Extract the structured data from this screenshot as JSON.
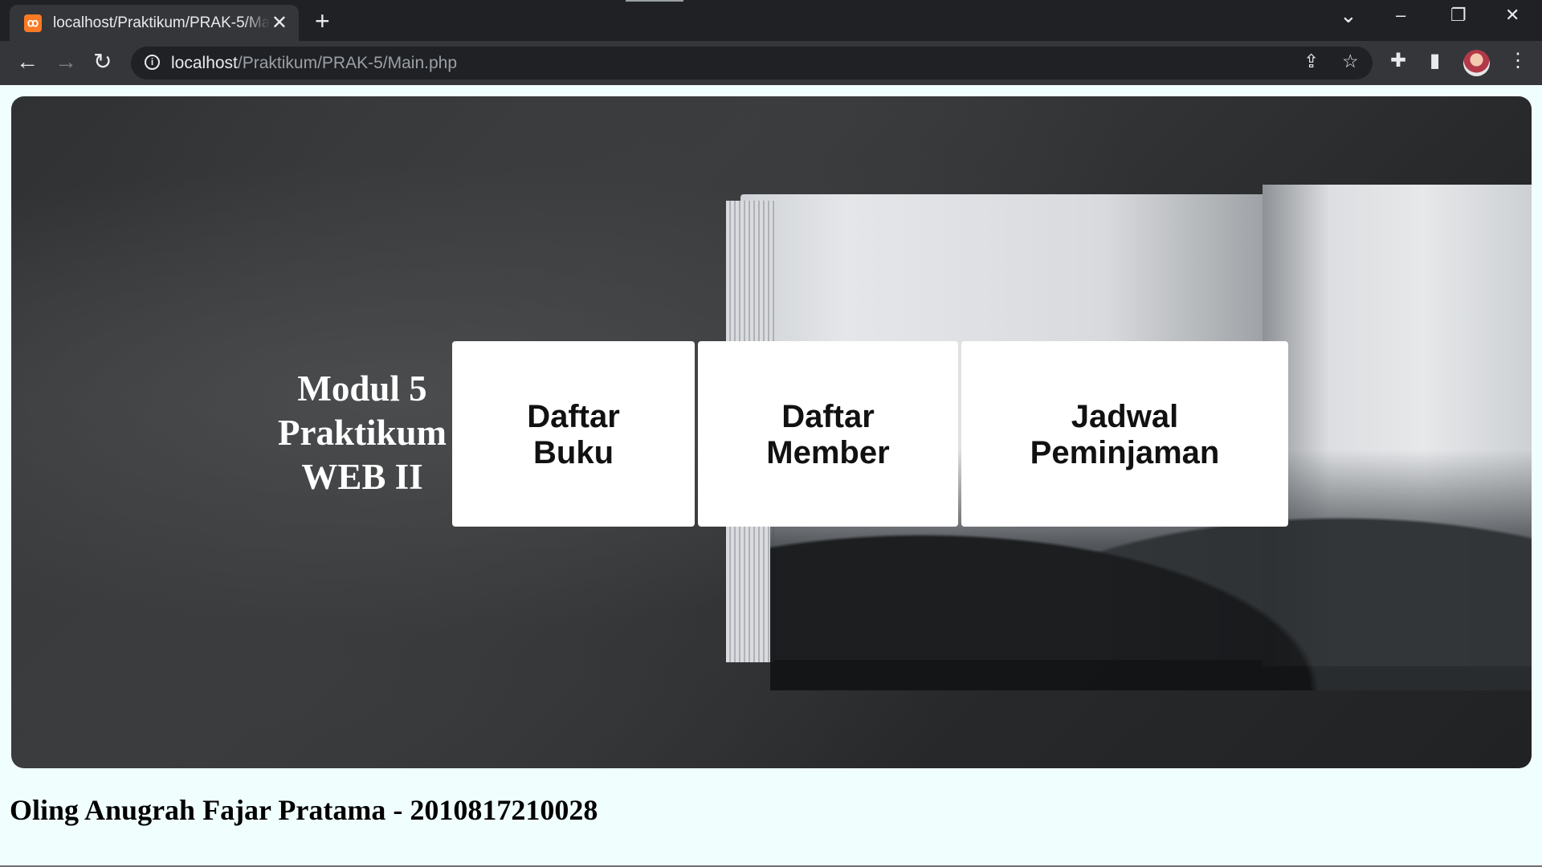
{
  "browser": {
    "tab_title": "localhost/Praktikum/PRAK-5/Main.php",
    "favicon_glyph": "ꝏ",
    "url_host": "localhost",
    "url_path": "/Praktikum/PRAK-5/Main.php",
    "icons": {
      "tab_close": "✕",
      "new_tab": "+",
      "tab_search": "⌄",
      "minimize": "–",
      "restore": "❐",
      "close": "✕",
      "back": "←",
      "forward": "→",
      "reload": "↻",
      "site_info": "i",
      "share": "⇪",
      "bookmark": "☆",
      "extensions": "✚",
      "side_panel": "▮",
      "menu": "⋮"
    }
  },
  "page": {
    "hero_title_lines": [
      "Modul 5",
      "Praktikum",
      "WEB II"
    ],
    "menu": [
      {
        "lines": [
          "Daftar",
          "Buku"
        ]
      },
      {
        "lines": [
          "Daftar",
          "Member"
        ]
      },
      {
        "lines": [
          "Jadwal",
          "Peminjaman"
        ]
      }
    ],
    "footer": "Oling Anugrah Fajar Pratama - 2010817210028"
  }
}
